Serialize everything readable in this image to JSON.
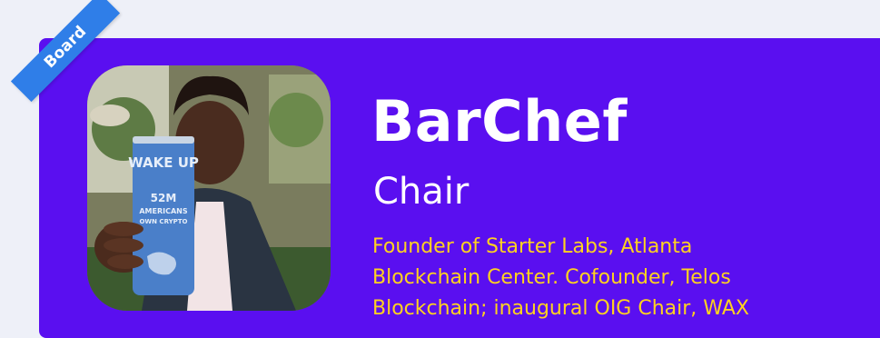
{
  "badge": {
    "label": "Board"
  },
  "profile": {
    "name": "BarChef",
    "role": "Chair",
    "bio_lines": [
      "Founder of Starter Labs, Atlanta",
      "Blockchain Center. Cofounder, Telos",
      "Blockchain; inaugural OIG Chair, WAX"
    ],
    "photo": {
      "can_text_lines": [
        "WAKE UP",
        "52M",
        "AMERICANS",
        "OWN CRYPTO"
      ]
    }
  },
  "colors": {
    "page_background": "#eef0f8",
    "card_background": "#5a0ff0",
    "badge_background": "#2f7ee8",
    "name_text": "#ffffff",
    "bio_text": "#ffd21f"
  }
}
